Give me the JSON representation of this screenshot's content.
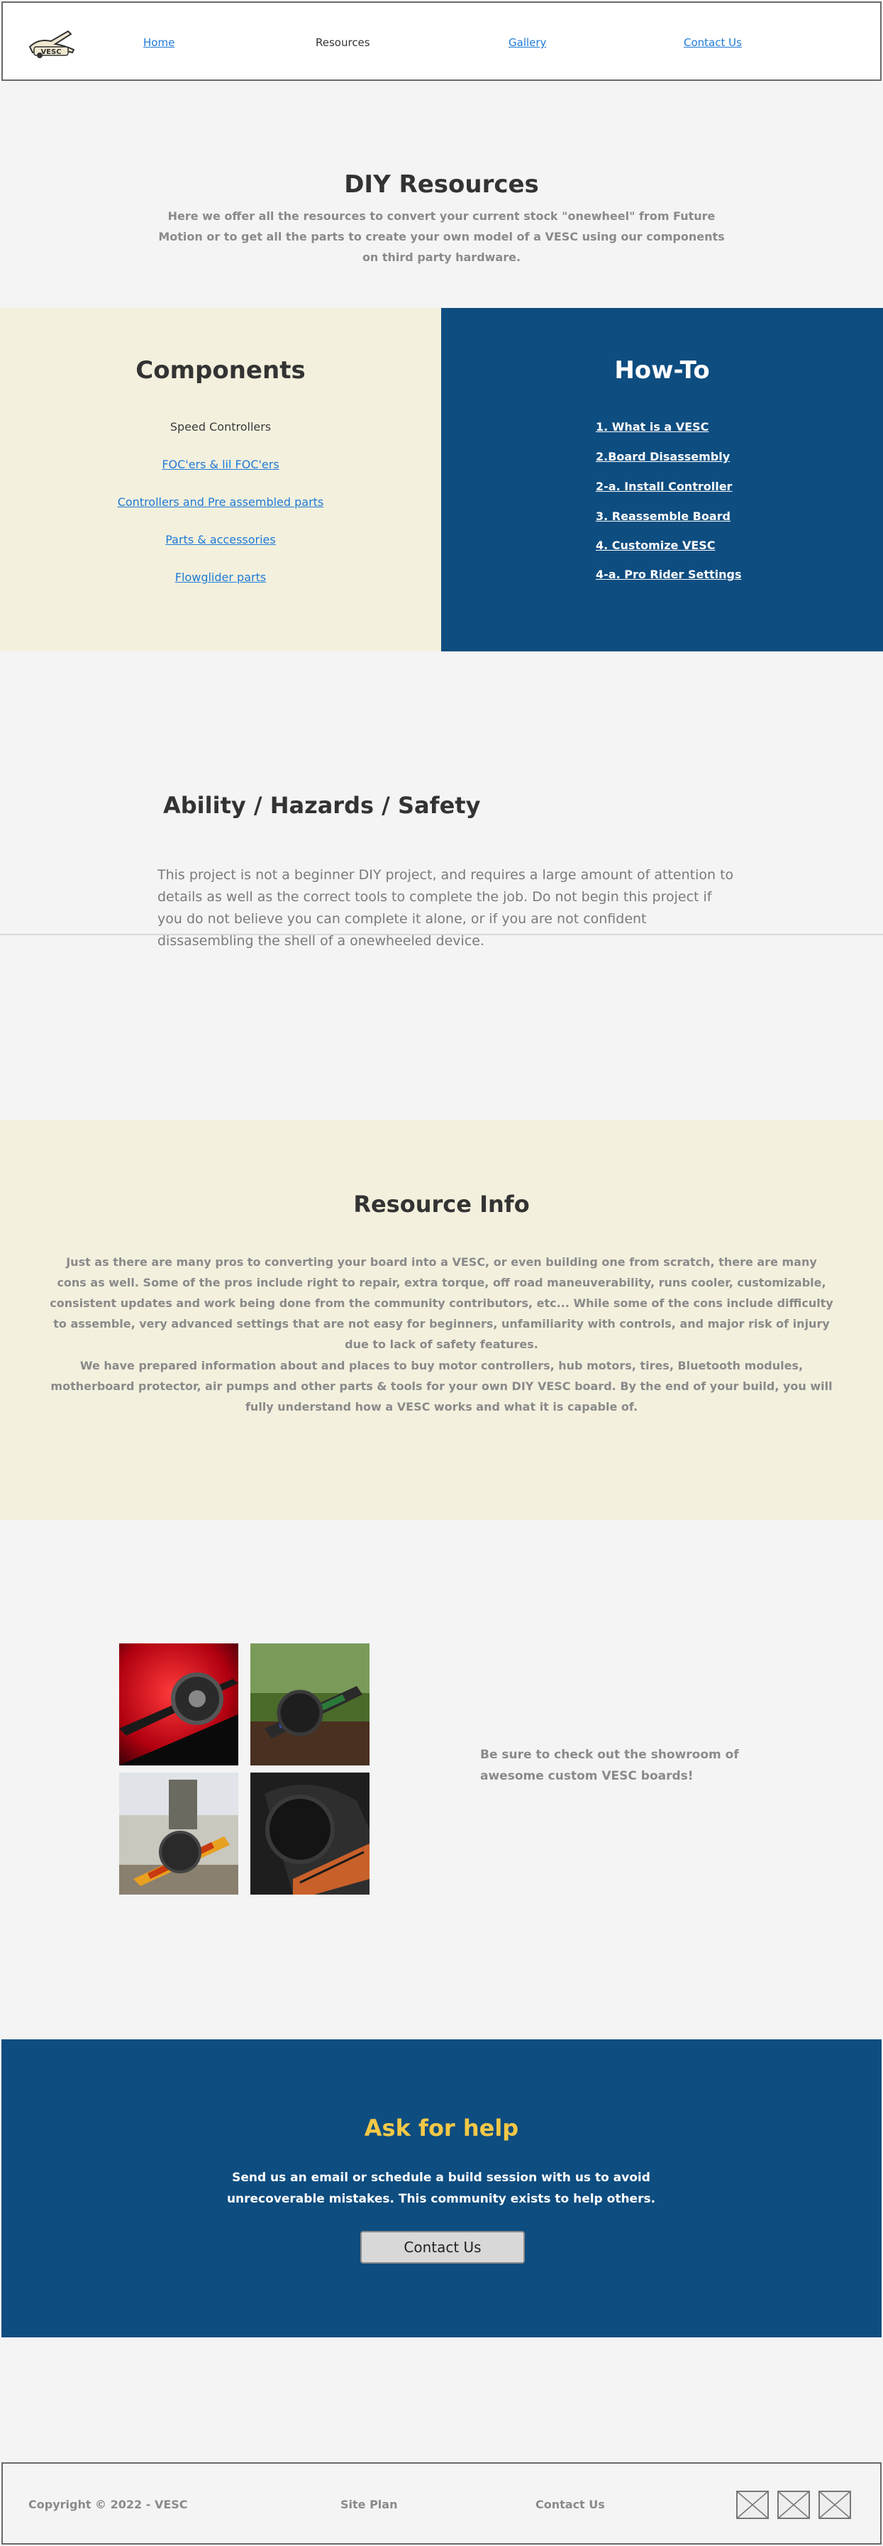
{
  "header": {
    "logo_text": "VESC",
    "nav": [
      {
        "label": "Home"
      },
      {
        "label": "Resources"
      },
      {
        "label": "Gallery"
      },
      {
        "label": "Contact Us"
      }
    ]
  },
  "diy": {
    "title": "DIY Resources",
    "text": "Here we offer all the resources to convert your current stock \"onewheel\" from Future Motion or to get all the parts to create your own model of a VESC using our components on third party hardware."
  },
  "components": {
    "title": "Components",
    "items": [
      {
        "label": "Speed Controllers"
      },
      {
        "label": "FOC'ers & lil FOC'ers"
      },
      {
        "label": "Controllers and Pre assembled parts"
      },
      {
        "label": "Parts & accessories"
      },
      {
        "label": "Flowglider parts"
      }
    ]
  },
  "howto": {
    "title": "How-To",
    "items": [
      {
        "label": "1. What is a VESC"
      },
      {
        "label": "2.Board Disassembly"
      },
      {
        "label": "2-a. Install Controller"
      },
      {
        "label": "3. Reassemble Board"
      },
      {
        "label": "4. Customize VESC"
      },
      {
        "label": "4-a. Pro Rider Settings"
      }
    ]
  },
  "safety": {
    "title": "Ability / Hazards / Safety",
    "text": "This project is not a beginner DIY project, and requires a large amount of attention to details as well as the correct tools to complete the job. Do not begin this project if you do not believe you can complete it alone, or if you are not confident dissasembling the shell of a onewheeled device."
  },
  "resource": {
    "title": "Resource Info",
    "p1": "Just as there are many pros to converting your board into a VESC, or even building one from scratch, there are many cons as well. Some of the pros include right to repair, extra torque, off road maneuverability, runs cooler, customizable, consistent updates and work being done from the community contributors, etc... While some of the cons include difficulty to assemble, very advanced settings that are not easy for beginners, unfamiliarity with controls, and major risk of injury due to lack of safety features.",
    "p2": "We have prepared information about and places to buy motor controllers, hub motors, tires, Bluetooth modules, motherboard protector, air pumps and other parts & tools for your own DIY VESC board. By the end of your build, you will fully understand how a VESC works and what it is capable of."
  },
  "gallery": {
    "text": "Be sure to check out the showroom of awesome custom VESC boards!"
  },
  "help": {
    "title": "Ask for help",
    "text": "Send us an email or schedule a build session with us to avoid unrecoverable mistakes. This community exists to help others.",
    "button_label": "Contact Us"
  },
  "footer": {
    "copyright": "Copyright © 2022 - VESC",
    "site_plan": "Site Plan",
    "contact": "Contact Us"
  },
  "colors": {
    "accent_blue": "#0e4d80",
    "cream": "#f3f0de",
    "link": "#1f7ad6",
    "help_title": "#f3c846"
  }
}
